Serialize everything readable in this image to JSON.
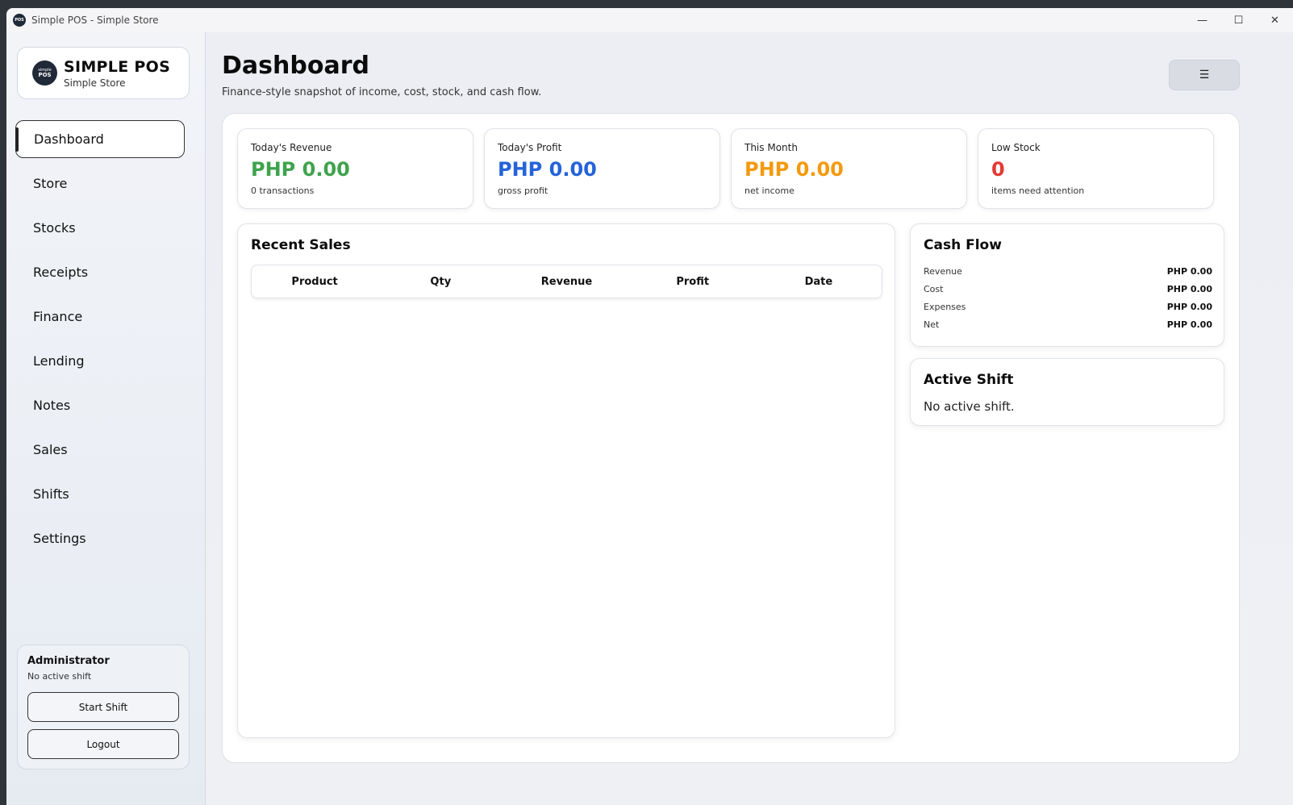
{
  "window": {
    "title": "Simple POS - Simple Store",
    "controls": {
      "minimize": "—",
      "maximize": "☐",
      "close": "✕"
    }
  },
  "brand": {
    "logo_top": "simple",
    "logo_bottom": "POS",
    "name": "SIMPLE POS",
    "store": "Simple Store"
  },
  "sidebar": {
    "items": [
      {
        "label": "Dashboard",
        "active": true
      },
      {
        "label": "Store"
      },
      {
        "label": "Stocks"
      },
      {
        "label": "Receipts"
      },
      {
        "label": "Finance"
      },
      {
        "label": "Lending"
      },
      {
        "label": "Notes"
      },
      {
        "label": "Sales"
      },
      {
        "label": "Shifts"
      },
      {
        "label": "Settings"
      }
    ],
    "user": {
      "name": "Administrator",
      "status": "No active shift",
      "start_shift_label": "Start Shift",
      "logout_label": "Logout"
    }
  },
  "header": {
    "title": "Dashboard",
    "subtitle": "Finance-style snapshot of income, cost, stock, and cash flow.",
    "menu_icon": "☰"
  },
  "stats": [
    {
      "label": "Today's Revenue",
      "value": "PHP 0.00",
      "note": "0 transactions",
      "color": "#3fa34d"
    },
    {
      "label": "Today's Profit",
      "value": "PHP 0.00",
      "note": "gross profit",
      "color": "#2563d9"
    },
    {
      "label": "This Month",
      "value": "PHP 0.00",
      "note": "net income",
      "color": "#f29a0e"
    },
    {
      "label": "Low Stock",
      "value": "0",
      "note": "items need attention",
      "color": "#e53935"
    }
  ],
  "recent_sales": {
    "title": "Recent Sales",
    "columns": [
      "Product",
      "Qty",
      "Revenue",
      "Profit",
      "Date"
    ]
  },
  "cash_flow": {
    "title": "Cash Flow",
    "rows": [
      {
        "label": "Revenue",
        "value": "PHP 0.00"
      },
      {
        "label": "Cost",
        "value": "PHP 0.00"
      },
      {
        "label": "Expenses",
        "value": "PHP 0.00"
      },
      {
        "label": "Net",
        "value": "PHP 0.00"
      }
    ]
  },
  "active_shift": {
    "title": "Active Shift",
    "text": "No active shift."
  }
}
